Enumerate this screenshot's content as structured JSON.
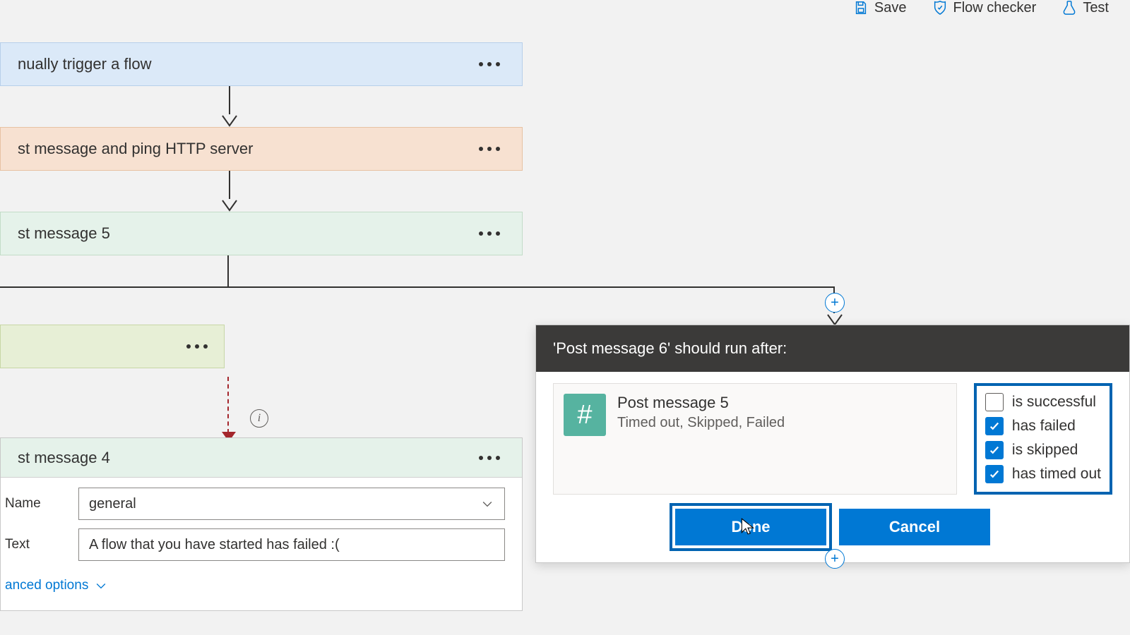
{
  "toolbar": {
    "save": "Save",
    "check": "Flow checker",
    "test": "Test"
  },
  "nodes": {
    "trigger": "nually trigger a flow",
    "ping": "st message and ping HTTP server",
    "msg5": "st message 5",
    "msg4": "st message 4"
  },
  "msg4_form": {
    "name_label": "Name",
    "name_value": "general",
    "text_label": "Text",
    "text_value": "A flow that you have started has failed :(",
    "advanced_options": "anced options"
  },
  "dialog": {
    "title": "'Post message 6' should run after:",
    "predecessor_name": "Post message 5",
    "predecessor_sub": "Timed out, Skipped, Failed",
    "conditions": [
      {
        "label": "is successful",
        "checked": false
      },
      {
        "label": "has failed",
        "checked": true
      },
      {
        "label": "is skipped",
        "checked": true
      },
      {
        "label": "has timed out",
        "checked": true
      }
    ],
    "done": "Done",
    "cancel": "Cancel"
  }
}
